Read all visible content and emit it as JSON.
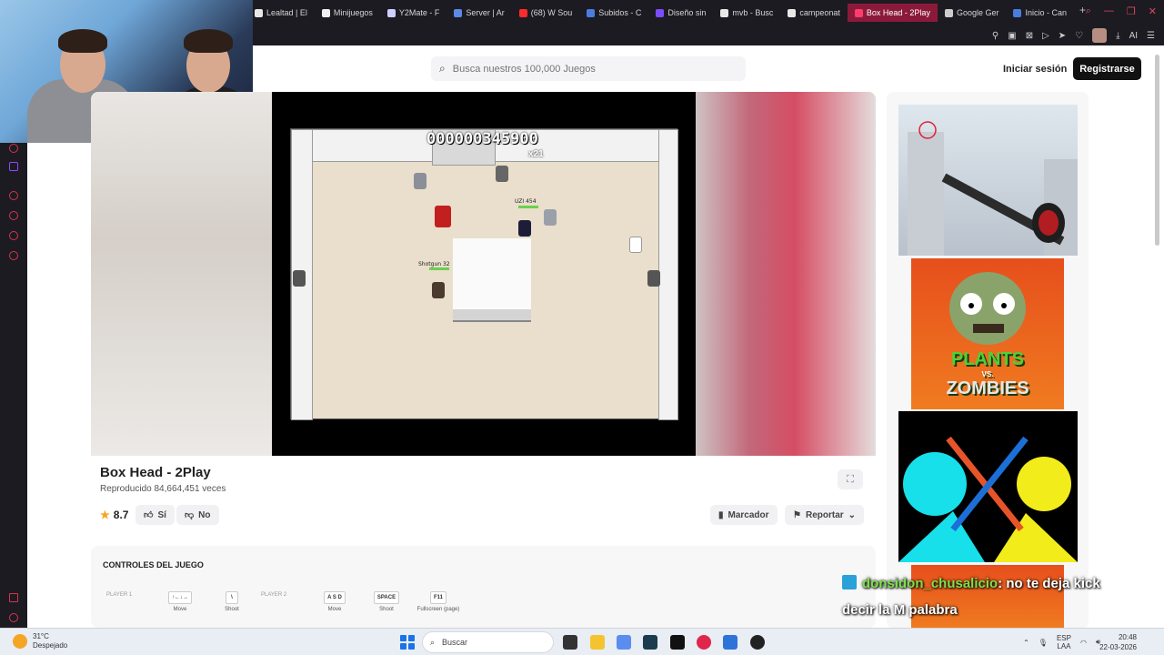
{
  "browser": {
    "tabs": [
      {
        "label": "Lealtad | El",
        "color": "#e8e8e8"
      },
      {
        "label": "Minijuegos",
        "color": "#f1f1f1"
      },
      {
        "label": "Y2Mate - F",
        "color": "#cfcfff"
      },
      {
        "label": "Server | Ar",
        "color": "#5c8ae6"
      },
      {
        "label": "(68) W Sou",
        "color": "#ff2b2b"
      },
      {
        "label": "Subidos - C",
        "color": "#4b7de0"
      },
      {
        "label": "Diseño sin",
        "color": "#7c4dff"
      },
      {
        "label": "mvb - Busc",
        "color": "#e8e8e8"
      },
      {
        "label": "campeonat",
        "color": "#e8e8e8"
      },
      {
        "label": "Box Head - 2Play",
        "color": "#ff3d6b"
      },
      {
        "label": "Google Ger",
        "color": "#cccccc"
      },
      {
        "label": "Inicio - Can",
        "color": "#4b7de0"
      }
    ],
    "new_tab": "+",
    "toolbar_ai": "AI"
  },
  "header": {
    "search_placeholder": "Busca nuestros 100,000 Juegos",
    "login": "Iniciar sesión",
    "register": "Registrarse"
  },
  "game_screen": {
    "score": "000000345900",
    "combo": "x21",
    "labels": [
      "UZI 454",
      "Shotgun 32"
    ]
  },
  "game": {
    "title": "Box Head - 2Play",
    "plays": "Reproducido 84,664,451 veces",
    "rating": "8.7",
    "yes": "Sí",
    "no": "No",
    "bookmark": "Marcador",
    "report": "Reportar"
  },
  "controls": {
    "title": "CONTROLES DEL JUEGO",
    "player1": "PLAYER 1",
    "player2": "PLAYER 2",
    "items": [
      {
        "key": "↑←↓→",
        "label": "Move"
      },
      {
        "key": "\\",
        "label": "Shoot"
      },
      {
        "key": "A S D",
        "label": "Move"
      },
      {
        "key": "SPACE",
        "label": "Shoot"
      },
      {
        "key": "F11",
        "label": "Fullscreen (page)"
      }
    ]
  },
  "ads": {
    "pvz_line1": "PLANTS",
    "pvz_vs": "VS.",
    "pvz_line2": "ZOMBIES"
  },
  "chat": {
    "user": "donsidon_chusalicio",
    "message": ": no te deja kick",
    "message2": "decir la M palabra"
  },
  "taskbar": {
    "temp": "31°C",
    "weather": "Despejado",
    "search": "Buscar",
    "lang": "ESP",
    "lang2": "LAA",
    "time": "20:48",
    "date": "22-03-2026"
  },
  "colors": {
    "accent": "#111111",
    "active_tab": "#8b1a3a",
    "chat_user": "#7ee04a"
  }
}
